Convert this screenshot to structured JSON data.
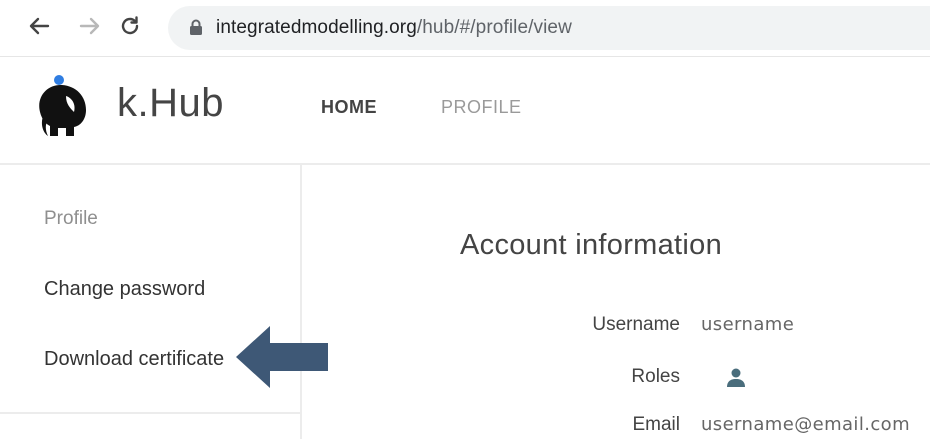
{
  "browser": {
    "url_host": "integratedmodelling.org",
    "url_path": "/hub/#/profile/view",
    "back_icon": "arrow-left-icon",
    "forward_icon": "arrow-right-icon",
    "reload_icon": "reload-icon",
    "lock_icon": "lock-icon"
  },
  "header": {
    "brand": "k.Hub",
    "logo_icon": "elephant-logo-icon",
    "nav": [
      {
        "label": "HOME",
        "active": true
      },
      {
        "label": "PROFILE",
        "active": false
      }
    ]
  },
  "sidebar": {
    "items": [
      {
        "label": "Profile",
        "active": true
      },
      {
        "label": "Change password",
        "active": false
      },
      {
        "label": "Download certificate",
        "active": false
      }
    ],
    "pointer_icon": "arrow-left-pointer-icon"
  },
  "main": {
    "title": "Account information",
    "fields": {
      "username": {
        "label": "Username",
        "value": "username"
      },
      "roles": {
        "label": "Roles",
        "icon": "person-icon"
      },
      "email": {
        "label": "Email",
        "value": "username@email.com"
      }
    }
  },
  "colors": {
    "accent_blue": "#2f7de1",
    "arrow": "#3e5876",
    "address_bar": "#f1f3f4",
    "role_icon": "#4a6d7c"
  }
}
